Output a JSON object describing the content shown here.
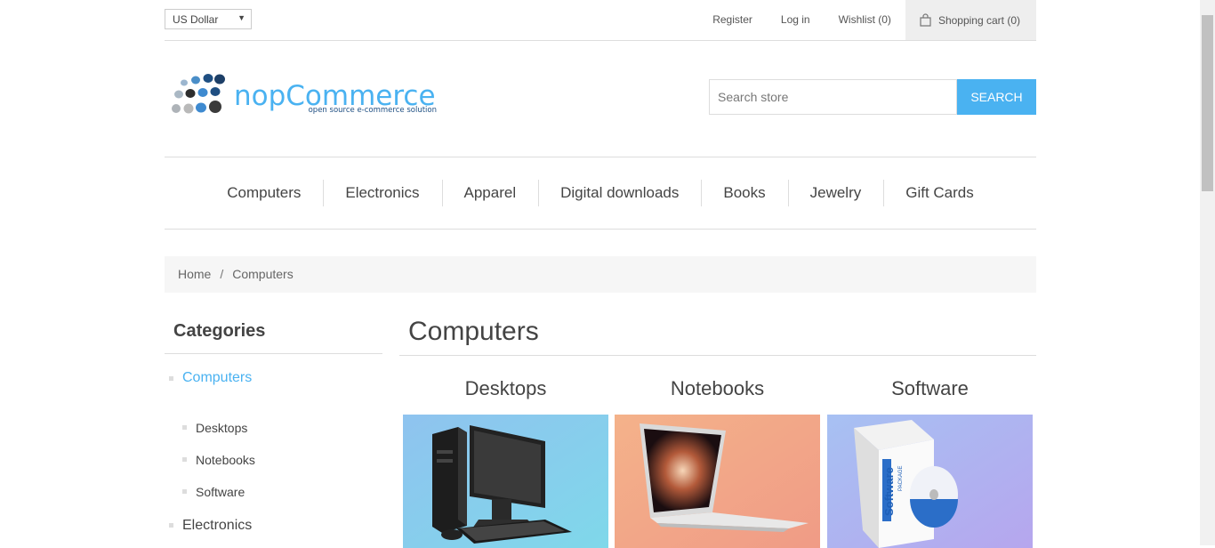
{
  "header": {
    "currency": "US Dollar",
    "links": {
      "register": "Register",
      "login": "Log in",
      "wishlist": "Wishlist (0)",
      "cart": "Shopping cart (0)"
    }
  },
  "logo": {
    "name": "nopCommerce",
    "tagline": "open source e-commerce solution"
  },
  "search": {
    "placeholder": "Search store",
    "button": "Search"
  },
  "menu": [
    "Computers",
    "Electronics",
    "Apparel",
    "Digital downloads",
    "Books",
    "Jewelry",
    "Gift Cards"
  ],
  "breadcrumb": {
    "home": "Home",
    "separator": "/",
    "current": "Computers"
  },
  "side": {
    "title": "Categories",
    "computers": "Computers",
    "desktops": "Desktops",
    "notebooks": "Notebooks",
    "software": "Software",
    "electronics": "Electronics"
  },
  "main": {
    "title": "Computers",
    "subcategories": [
      "Desktops",
      "Notebooks",
      "Software"
    ]
  },
  "colors": {
    "accent": "#4ab2f1"
  }
}
